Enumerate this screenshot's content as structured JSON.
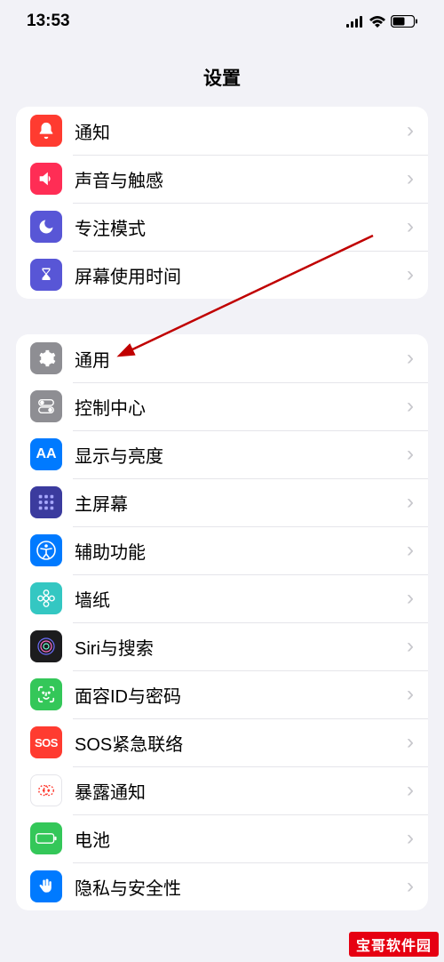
{
  "status": {
    "time": "13:53"
  },
  "title": "设置",
  "groups": [
    {
      "items": [
        {
          "id": "notifications",
          "label": "通知",
          "icon": "bell",
          "bg": "#ff3b30"
        },
        {
          "id": "sounds",
          "label": "声音与触感",
          "icon": "speaker",
          "bg": "#ff2d55"
        },
        {
          "id": "focus",
          "label": "专注模式",
          "icon": "moon",
          "bg": "#5856d6"
        },
        {
          "id": "screentime",
          "label": "屏幕使用时间",
          "icon": "hourglass",
          "bg": "#5856d6"
        }
      ]
    },
    {
      "items": [
        {
          "id": "general",
          "label": "通用",
          "icon": "gear",
          "bg": "#8e8e93"
        },
        {
          "id": "control-center",
          "label": "控制中心",
          "icon": "switches",
          "bg": "#8e8e93"
        },
        {
          "id": "display",
          "label": "显示与亮度",
          "icon": "aa",
          "bg": "#007aff"
        },
        {
          "id": "home-screen",
          "label": "主屏幕",
          "icon": "grid",
          "bg": "#3a3a8f"
        },
        {
          "id": "accessibility",
          "label": "辅助功能",
          "icon": "person-circle",
          "bg": "#007aff"
        },
        {
          "id": "wallpaper",
          "label": "墙纸",
          "icon": "flower",
          "bg": "#00c7be"
        },
        {
          "id": "siri",
          "label": "Siri与搜索",
          "icon": "siri",
          "bg": "#1c1c1e"
        },
        {
          "id": "faceid",
          "label": "面容ID与密码",
          "icon": "faceid",
          "bg": "#34c759"
        },
        {
          "id": "sos",
          "label": "SOS紧急联络",
          "icon": "sos",
          "bg": "#ff3b30"
        },
        {
          "id": "exposure",
          "label": "暴露通知",
          "icon": "exposure",
          "bg": "#ffffff"
        },
        {
          "id": "battery",
          "label": "电池",
          "icon": "battery",
          "bg": "#34c759"
        },
        {
          "id": "privacy",
          "label": "隐私与安全性",
          "icon": "hand",
          "bg": "#007aff"
        }
      ]
    }
  ],
  "watermark": "宝哥软件园"
}
